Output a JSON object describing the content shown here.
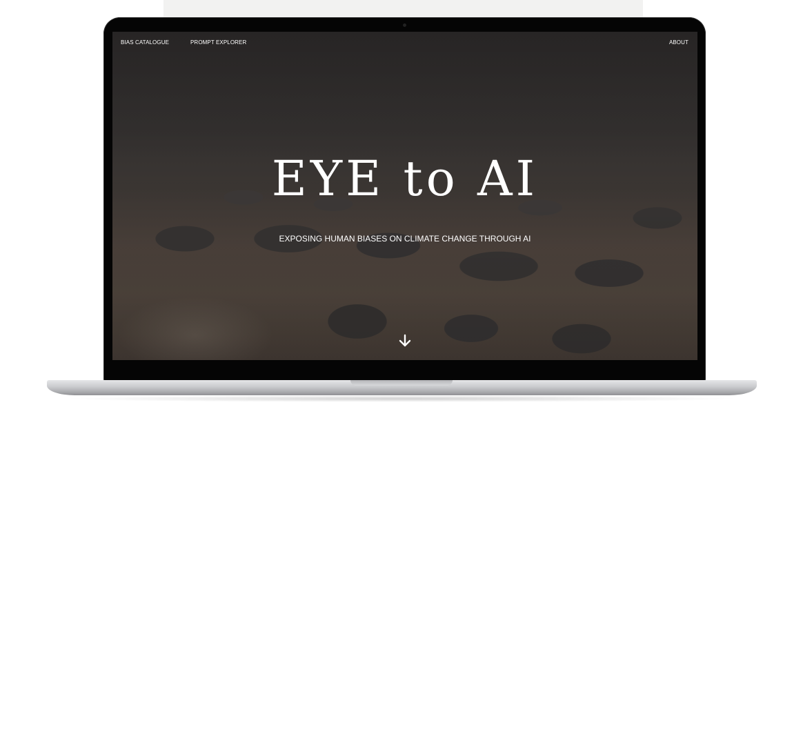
{
  "nav": {
    "bias_catalogue": "BIAS CATALOGUE",
    "prompt_explorer": "PROMPT EXPLORER",
    "about": "ABOUT"
  },
  "hero": {
    "title": "EYE to AI",
    "subtitle": "EXPOSING HUMAN BIASES ON CLIMATE CHANGE THROUGH AI",
    "scroll_icon": "arrow-down-icon"
  },
  "colors": {
    "nav_text": "#ffffff",
    "title_text": "#ffffff",
    "screen_bg": "#33302f",
    "bezel": "#050505"
  }
}
